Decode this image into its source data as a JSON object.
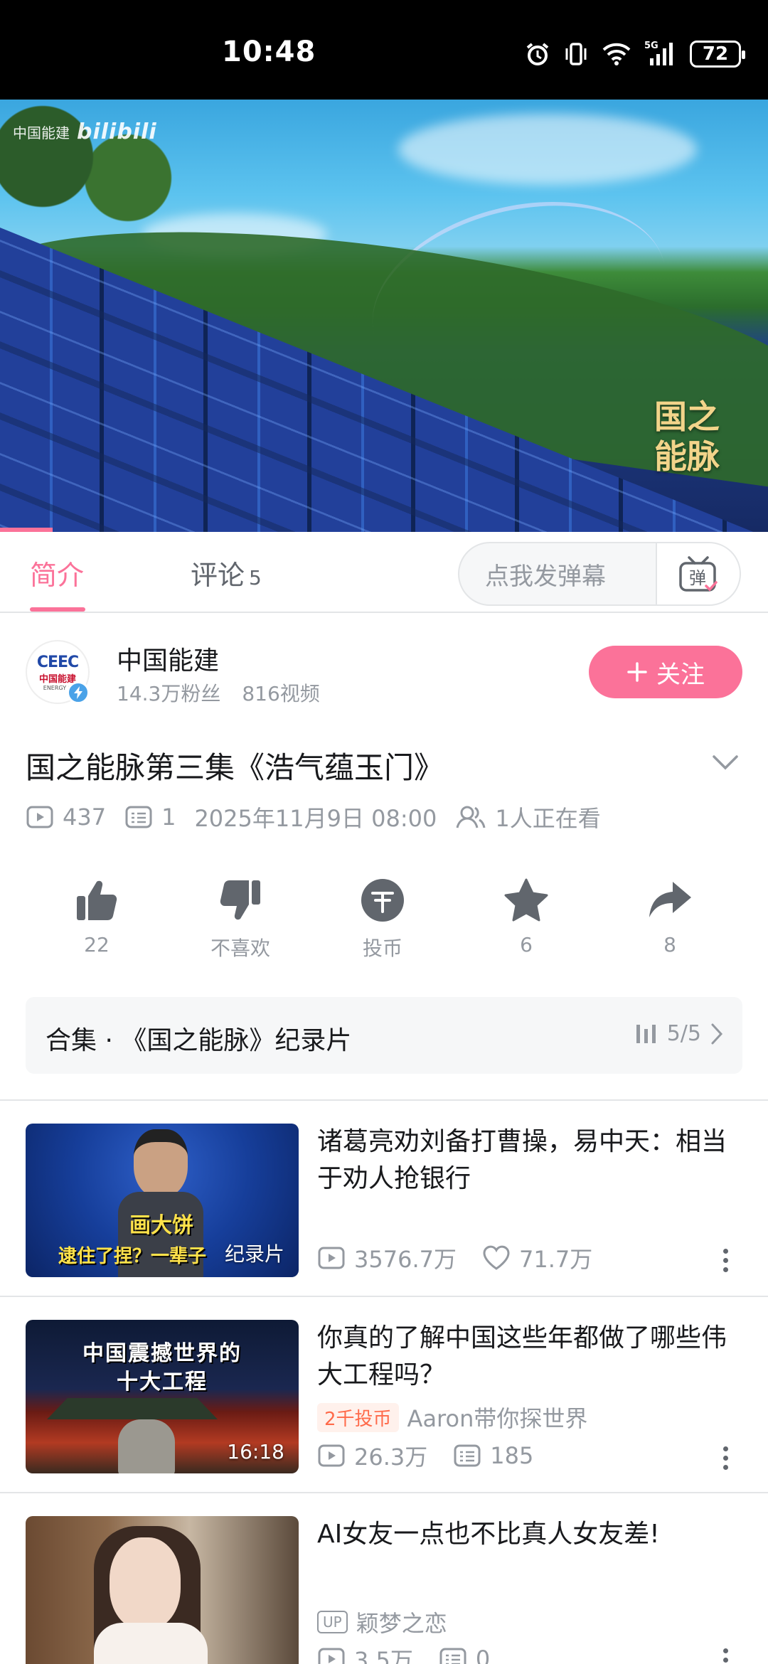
{
  "status_bar": {
    "time": "10:48",
    "battery": "72",
    "network": "5G"
  },
  "player": {
    "watermark_channel": "中国能建",
    "watermark_brand": "bilibili",
    "series_logo": "国之能脉"
  },
  "tabs": [
    {
      "label": "简介",
      "count": ""
    },
    {
      "label": "评论",
      "count": "5"
    }
  ],
  "danmaku": {
    "placeholder": "点我发弹幕",
    "button_label": "弹"
  },
  "uploader": {
    "name": "中国能建",
    "fans": "14.3万粉丝",
    "videos": "816视频",
    "avatar_text": {
      "logo": "CEEC",
      "cn": "中国能建",
      "en": "ENERGY C"
    },
    "follow_label": "关注"
  },
  "video": {
    "title": "国之能脉第三集《浩气蕴玉门》",
    "plays": "437",
    "danmaku_count": "1",
    "date": "2025年11月9日 08:00",
    "watching": "1人正在看"
  },
  "actions": [
    {
      "icon": "like-icon",
      "label": "22"
    },
    {
      "icon": "dislike-icon",
      "label": "不喜欢"
    },
    {
      "icon": "coin-icon",
      "label": "投币"
    },
    {
      "icon": "favorite-icon",
      "label": "6"
    },
    {
      "icon": "share-icon",
      "label": "8"
    }
  ],
  "collection": {
    "title": "合集 · 《国之能脉》纪录片",
    "progress": "5/5"
  },
  "recommendations": [
    {
      "title": "诸葛亮劝刘备打曹操，易中天：相当于劝人抢银行",
      "badge": "纪录片",
      "thumb_caption1": "画大饼",
      "thumb_caption2": "逮住了捏？一辈子",
      "plays": "3576.7万",
      "likes": "71.7万"
    },
    {
      "title": "你真的了解中国这些年都做了哪些伟大工程吗？",
      "badge": "16:18",
      "thumb_caption1": "中国震撼世界的",
      "thumb_caption2": "十大工程",
      "coin_tag": "2千投币",
      "uploader": "Aaron带你探世界",
      "plays": "26.3万",
      "danmaku": "185"
    },
    {
      "title": "AI女友一点也不比真人女友差!",
      "up_tag": "UP",
      "uploader": "颖梦之恋",
      "plays": "3.5万",
      "danmaku": "0"
    }
  ],
  "colors": {
    "accent": "#fb7299",
    "text": "#18191c",
    "muted": "#9499a0"
  }
}
